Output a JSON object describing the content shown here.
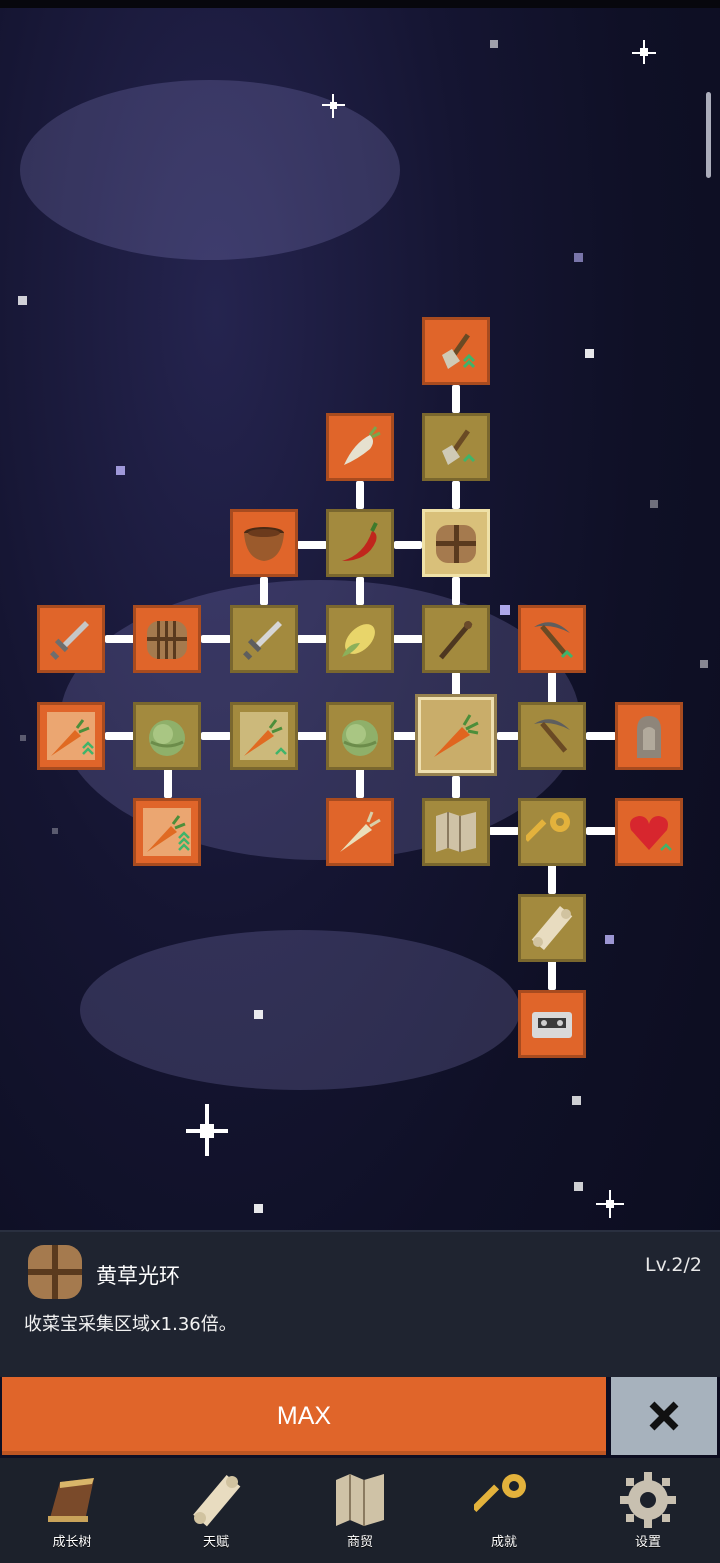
{
  "skill_tree": {
    "nodes": [
      {
        "id": "shovel-top",
        "icon": "shovel-icon",
        "style": "orange"
      },
      {
        "id": "radish",
        "icon": "radish-icon",
        "style": "orange"
      },
      {
        "id": "shovel-2",
        "icon": "shovel-icon",
        "style": "olive"
      },
      {
        "id": "bowl",
        "icon": "wooden-bowl-icon",
        "style": "orange"
      },
      {
        "id": "chili",
        "icon": "chili-pepper-icon",
        "style": "olive"
      },
      {
        "id": "hay-bale-top",
        "icon": "hay-bale-icon",
        "style": "gold"
      },
      {
        "id": "sword-1",
        "icon": "sword-icon",
        "style": "orange"
      },
      {
        "id": "hay-bale-left",
        "icon": "hay-bale-icon",
        "style": "orange"
      },
      {
        "id": "sword-2",
        "icon": "sword-icon",
        "style": "olive"
      },
      {
        "id": "corn",
        "icon": "corn-icon",
        "style": "olive"
      },
      {
        "id": "staff",
        "icon": "wooden-staff-icon",
        "style": "olive"
      },
      {
        "id": "pickaxe-top",
        "icon": "pickaxe-icon",
        "style": "orange"
      },
      {
        "id": "carrot-boost-1",
        "icon": "carrot-boost-icon",
        "style": "orange"
      },
      {
        "id": "cabbage-1",
        "icon": "cabbage-icon",
        "style": "olive"
      },
      {
        "id": "carrot-boost-2",
        "icon": "carrot-boost-icon",
        "style": "olive"
      },
      {
        "id": "cabbage-2",
        "icon": "cabbage-icon",
        "style": "olive"
      },
      {
        "id": "carrot-center",
        "icon": "carrot-icon",
        "style": "selected"
      },
      {
        "id": "pickaxe-2",
        "icon": "pickaxe-icon",
        "style": "olive"
      },
      {
        "id": "statue",
        "icon": "stone-statue-icon",
        "style": "orange"
      },
      {
        "id": "carrot-boost-3",
        "icon": "carrot-boost-icon",
        "style": "orange"
      },
      {
        "id": "parsnip",
        "icon": "parsnip-icon",
        "style": "orange"
      },
      {
        "id": "map",
        "icon": "map-icon",
        "style": "olive"
      },
      {
        "id": "golden-key",
        "icon": "golden-key-icon",
        "style": "olive"
      },
      {
        "id": "heart",
        "icon": "heart-icon",
        "style": "orange"
      },
      {
        "id": "scroll",
        "icon": "scroll-icon",
        "style": "olive"
      },
      {
        "id": "cassette",
        "icon": "cassette-icon",
        "style": "orange"
      }
    ]
  },
  "info_panel": {
    "icon": "hay-bale-icon",
    "title": "黄草光环",
    "level": "Lv.2/2",
    "description": "收菜宝采集区域x1.36倍。"
  },
  "actions": {
    "max_label": "MAX",
    "close_icon": "close-icon"
  },
  "nav": {
    "items": [
      {
        "label": "成长树",
        "icon": "book-icon"
      },
      {
        "label": "天赋",
        "icon": "scroll-icon"
      },
      {
        "label": "商贸",
        "icon": "map-icon"
      },
      {
        "label": "成就",
        "icon": "golden-key-icon"
      },
      {
        "label": "设置",
        "icon": "gear-icon"
      }
    ]
  },
  "colors": {
    "orange": "#e0652a",
    "olive": "#a38a3e",
    "panel": "#1f2430",
    "close_button": "#a7b2bd"
  }
}
